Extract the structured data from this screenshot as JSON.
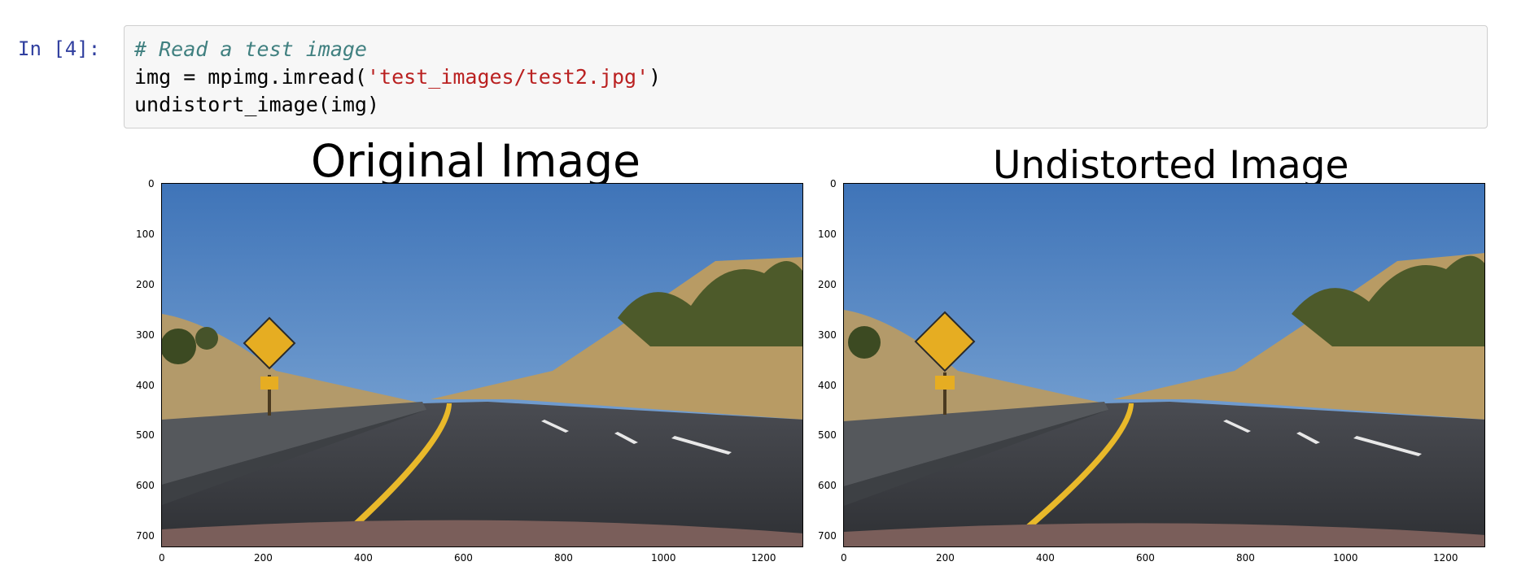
{
  "cell": {
    "prompt": "In [4]:",
    "code": {
      "comment": "# Read a test image",
      "line2_pre": "img = mpimg.imread(",
      "line2_str": "'test_images/test2.jpg'",
      "line2_post": ")",
      "line3": "undistort_image(img)"
    }
  },
  "output": {
    "plots": [
      {
        "title": "Original Image",
        "xticks": [
          "0",
          "200",
          "400",
          "600",
          "800",
          "1000",
          "1200"
        ],
        "yticks": [
          "0",
          "100",
          "200",
          "300",
          "400",
          "500",
          "600",
          "700"
        ],
        "image_subject": "road-scene-photo"
      },
      {
        "title": "Undistorted Image",
        "xticks": [
          "0",
          "200",
          "400",
          "600",
          "800",
          "1000",
          "1200"
        ],
        "yticks": [
          "0",
          "100",
          "200",
          "300",
          "400",
          "500",
          "600",
          "700"
        ],
        "image_subject": "road-scene-photo"
      }
    ]
  },
  "colors": {
    "prompt": "#303f9f",
    "comment": "#408080",
    "string": "#ba2121",
    "sky": "#4a7fc0",
    "road": "#3e4046",
    "lane_yellow": "#e9b92a"
  }
}
